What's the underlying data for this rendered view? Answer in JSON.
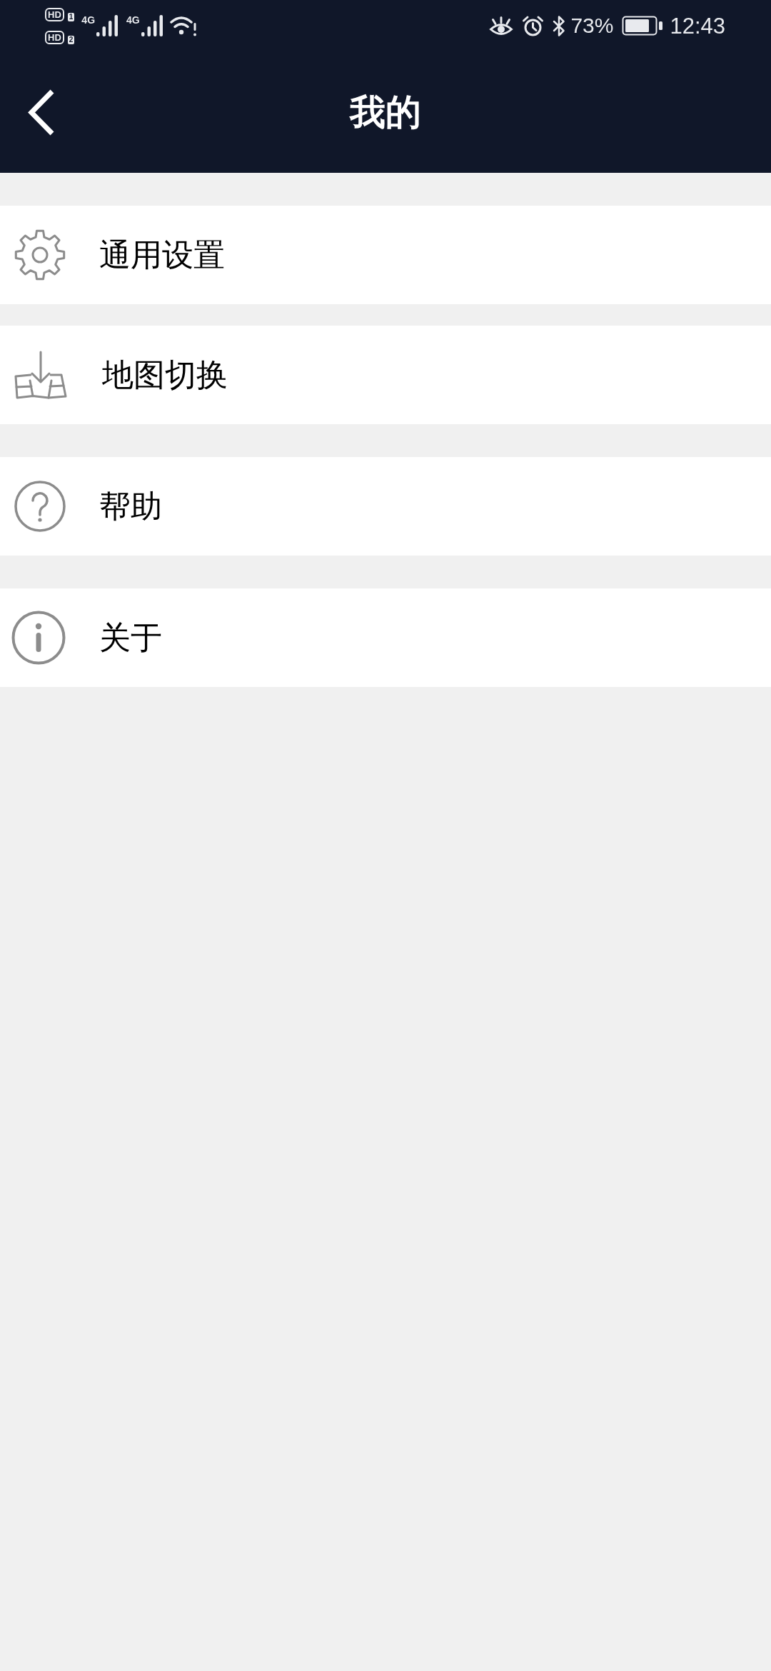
{
  "status_bar": {
    "sim_badges": [
      {
        "label": "HD",
        "slot": "1"
      },
      {
        "label": "HD",
        "slot": "2"
      }
    ],
    "networks": [
      {
        "type": "4G"
      },
      {
        "type": "4G"
      }
    ],
    "battery": "73%",
    "time": "12:43"
  },
  "header": {
    "title": "我的"
  },
  "menu_items": [
    {
      "label": "通用设置"
    },
    {
      "label": "地图切换"
    },
    {
      "label": "帮助"
    },
    {
      "label": "关于"
    }
  ]
}
